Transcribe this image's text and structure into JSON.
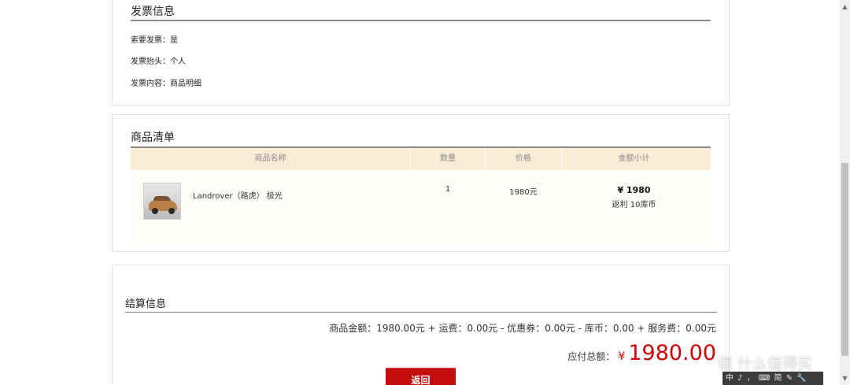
{
  "invoice": {
    "title": "发票信息",
    "lines": [
      "索要发票：是",
      "发票抬头：个人",
      "发票内容：商品明细"
    ]
  },
  "products": {
    "title": "商品清单",
    "columns": [
      "商品名称",
      "数量",
      "价格",
      "金额小计"
    ],
    "rows": [
      {
        "name": "Landrover（路虎） 极光",
        "quantity": "1",
        "price": "1980元",
        "subtotal": "¥ 1980",
        "rebate": "返利 10库币"
      }
    ]
  },
  "settlement": {
    "title": "结算信息",
    "summary": "商品金额：1980.00元 + 运费：0.00元 - 优惠券：0.00元 - 库币：0.00 + 服务费：0.00元",
    "total_label": "应付总额：",
    "currency": "¥",
    "total_amount": "1980.00",
    "back_button": "返回"
  },
  "watermark": "值 什么值得买",
  "ime_bar": "中 ♪ ， ⌨ 简 ✎ 🔧",
  "colors": {
    "accent_red": "#c30d0d",
    "price_red": "#d40000",
    "table_header_bg": "#fbecd6",
    "table_body_bg": "#fefcf6"
  }
}
